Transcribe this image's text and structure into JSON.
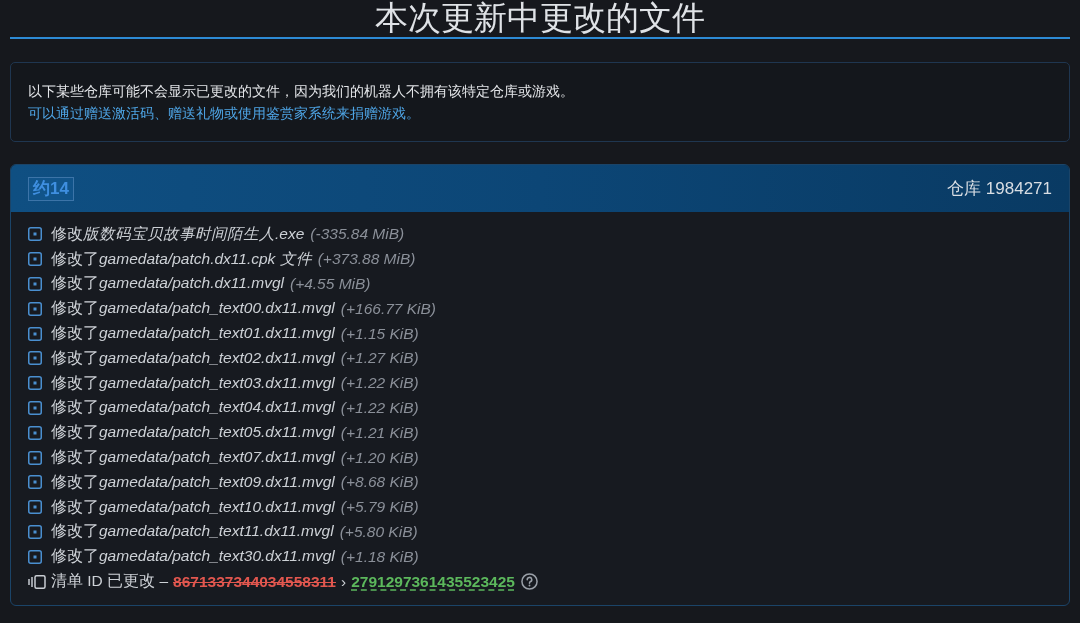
{
  "page_title": "本次更新中更改的文件",
  "notice": {
    "lines": [
      {
        "kind": "text",
        "text": "以下某些仓库可能不会显示已更改的文件，因为我们的机器人不拥有该特定仓库或游戏。"
      },
      {
        "kind": "link",
        "text": "可以通过赠送激活码、赠送礼物或使用鉴赏家系统来捐赠游戏。"
      }
    ]
  },
  "depot": {
    "badge": "约14",
    "label": "仓库 1984271",
    "files": [
      {
        "action": "修改",
        "path": "版数码宝贝故事时间陌生人.exe",
        "size": "(-335.84 MiB)"
      },
      {
        "action": "修改了",
        "path": "gamedata/patch.dx11.cpk 文件",
        "size": "(+373.88 MiB)"
      },
      {
        "action": "修改了",
        "path": "gamedata/patch.dx11.mvgl",
        "size": "(+4.55 MiB)"
      },
      {
        "action": "修改了",
        "path": "gamedata/patch_text00.dx11.mvgl",
        "size": "(+166.77 KiB)"
      },
      {
        "action": "修改了",
        "path": "gamedata/patch_text01.dx11.mvgl",
        "size": "(+1.15 KiB)"
      },
      {
        "action": "修改了",
        "path": "gamedata/patch_text02.dx11.mvgl",
        "size": "(+1.27 KiB)"
      },
      {
        "action": "修改了",
        "path": "gamedata/patch_text03.dx11.mvgl",
        "size": "(+1.22 KiB)"
      },
      {
        "action": "修改了",
        "path": "gamedata/patch_text04.dx11.mvgl",
        "size": "(+1.22 KiB)"
      },
      {
        "action": "修改了",
        "path": "gamedata/patch_text05.dx11.mvgl",
        "size": "(+1.21 KiB)"
      },
      {
        "action": "修改了",
        "path": "gamedata/patch_text07.dx11.mvgl",
        "size": "(+1.20 KiB)"
      },
      {
        "action": "修改了",
        "path": "gamedata/patch_text09.dx11.mvgl",
        "size": "(+8.68 KiB)"
      },
      {
        "action": "修改了",
        "path": "gamedata/patch_text10.dx11.mvgl",
        "size": "(+5.79 KiB)"
      },
      {
        "action": "修改了",
        "path": "gamedata/patch_text11.dx11.mvgl",
        "size": "(+5.80 KiB)"
      },
      {
        "action": "修改了",
        "path": "gamedata/patch_text30.dx11.mvgl",
        "size": "(+1.18 KiB)"
      }
    ],
    "manifest": {
      "label": "清单 ID 已更改 –",
      "old_id": "8671337344034558311",
      "separator": "›",
      "new_id": "2791297361435523425"
    }
  }
}
